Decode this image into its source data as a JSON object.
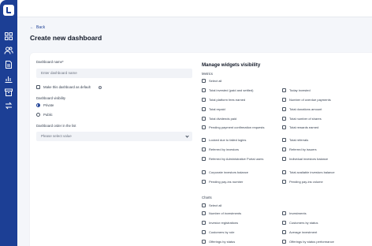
{
  "nav": {
    "icons": [
      "logo-icon",
      "dashboard-icon",
      "users-icon",
      "document-icon",
      "chart-icon",
      "archive-icon",
      "exchange-icon"
    ]
  },
  "header": {
    "back_label": "Back",
    "title": "Create new dashboard"
  },
  "form": {
    "name_label": "Dashboard name*",
    "name_placeholder": "Enter dashboard name",
    "default_label": "Make this dashboard as default",
    "visibility_label": "Dashboard visibility",
    "visibility_options": [
      "Private",
      "Public"
    ],
    "visibility_selected": "Private",
    "order_label": "Dashboard order in the list",
    "order_placeholder": "Please select value"
  },
  "widgets": {
    "title": "Manage widgets visibility",
    "metrics_title": "Metrics",
    "metrics_select_all": "Select all",
    "metrics": [
      [
        "Total invested (paid and settled)",
        "Today invested"
      ],
      [
        "Total platform fees earned",
        "Number of overdue payments"
      ],
      [
        "Total repaid",
        "Total donations amount"
      ],
      [
        "Total dividends paid",
        "Total number of shares"
      ],
      [
        "Pending payment confirmation requests",
        "Total rewards earned"
      ],
      [
        "Locked due to failed logins",
        "Total referrals"
      ],
      [
        "Referred by investors",
        "Referred by issuers"
      ],
      [
        "Referred by Administrative Portal users",
        "Individual investors balance"
      ],
      [
        "Corporate investors balance",
        "Total available investors balance"
      ],
      [
        "Pending pay-ins number",
        "Pending pay-ins volume"
      ]
    ],
    "charts_title": "Charts",
    "charts_select_all": "Select all",
    "charts": [
      [
        "Number of investments",
        "Investments"
      ],
      [
        "Investor registrations",
        "Customers by status"
      ],
      [
        "Customers by role",
        "Average investment"
      ],
      [
        "Offerings by status",
        "Offerings by status performance"
      ]
    ]
  }
}
